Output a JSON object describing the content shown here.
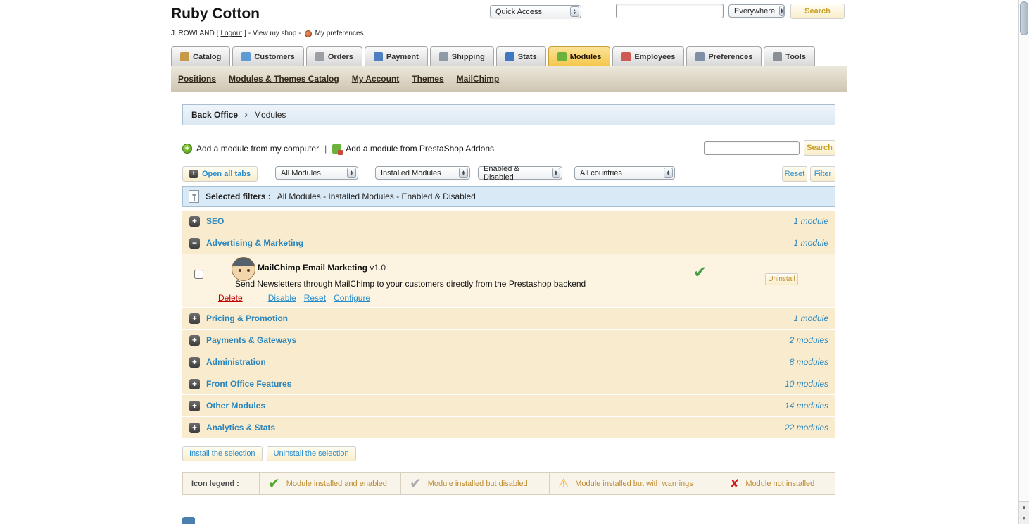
{
  "header": {
    "shop_name": "Ruby Cotton",
    "meta": {
      "user": "J. ROWLAND",
      "bracket_left": "[",
      "logout": "Logout",
      "bracket_right": "]",
      "dash": "-",
      "view_shop": "View my shop",
      "my_preferences": "My preferences"
    },
    "quick_access": "Quick Access",
    "search_scope": "Everywhere",
    "search_button": "Search"
  },
  "tabs": [
    {
      "label": "Catalog",
      "icon": "catalog-icon"
    },
    {
      "label": "Customers",
      "icon": "customers-icon"
    },
    {
      "label": "Orders",
      "icon": "orders-icon"
    },
    {
      "label": "Payment",
      "icon": "payment-icon"
    },
    {
      "label": "Shipping",
      "icon": "shipping-icon"
    },
    {
      "label": "Stats",
      "icon": "stats-icon"
    },
    {
      "label": "Modules",
      "icon": "modules-icon",
      "active": true
    },
    {
      "label": "Employees",
      "icon": "employees-icon"
    },
    {
      "label": "Preferences",
      "icon": "preferences-icon"
    },
    {
      "label": "Tools",
      "icon": "tools-icon"
    }
  ],
  "submenu": {
    "items": [
      "Positions",
      "Modules & Themes Catalog",
      "My Account",
      "Themes",
      "MailChimp"
    ]
  },
  "breadcrumb": {
    "root": "Back Office",
    "current": "Modules"
  },
  "toolbar": {
    "add_from_computer": "Add a module from my computer",
    "pipe": "|",
    "add_from_addons": "Add a module from PrestaShop Addons",
    "search_button": "Search"
  },
  "filters": {
    "open_all_tabs": "Open all tabs",
    "select_modules": "All Modules",
    "select_installed": "Installed Modules",
    "select_enabled": "Enabled & Disabled",
    "select_countries": "All countries",
    "reset": "Reset",
    "filter": "Filter",
    "selected_label": "Selected filters :",
    "selected_value": "All Modules - Installed Modules - Enabled & Disabled"
  },
  "categories": [
    {
      "name": "SEO",
      "count": "1 module",
      "expanded": false
    },
    {
      "name": "Advertising & Marketing",
      "count": "1 module",
      "expanded": true
    },
    {
      "name": "Pricing & Promotion",
      "count": "1 module",
      "expanded": false
    },
    {
      "name": "Payments & Gateways",
      "count": "2 modules",
      "expanded": false
    },
    {
      "name": "Administration",
      "count": "8 modules",
      "expanded": false
    },
    {
      "name": "Front Office Features",
      "count": "10 modules",
      "expanded": false
    },
    {
      "name": "Other Modules",
      "count": "14 modules",
      "expanded": false
    },
    {
      "name": "Analytics & Stats",
      "count": "22 modules",
      "expanded": false
    }
  ],
  "module": {
    "name": "MailChimp Email Marketing",
    "version": "v1.0",
    "description": "Send Newsletters through MailChimp to your customers directly from the Prestashop backend",
    "uninstall_label": "Uninstall",
    "actions": {
      "delete": "Delete",
      "disable": "Disable",
      "reset": "Reset",
      "configure": "Configure"
    }
  },
  "selection": {
    "install": "Install the selection",
    "uninstall": "Uninstall the selection"
  },
  "legend": {
    "label": "Icon legend :",
    "items": [
      {
        "icon": "check-green-icon",
        "text": "Module installed and enabled"
      },
      {
        "icon": "check-gray-icon",
        "text": "Module installed but disabled"
      },
      {
        "icon": "warning-icon",
        "text": "Module installed but with warnings"
      },
      {
        "icon": "cross-red-icon",
        "text": "Module not installed"
      }
    ]
  },
  "icons": {
    "plus": "+",
    "minus": "−",
    "check": "✔",
    "cross": "✘",
    "warning": "⚠",
    "sel_up": "▲",
    "sel_down": "▼",
    "breadcrumb_sep": "›",
    "scroll_up": "▲",
    "scroll_down": "▼"
  },
  "colors": {
    "accent_blue": "#268CCD",
    "row_tan": "#F9EBCD",
    "active_tab_yellow": "#F4C64C",
    "success_green": "#43A047",
    "error_red": "#D21C1C",
    "warning_orange": "#F5A81C"
  }
}
